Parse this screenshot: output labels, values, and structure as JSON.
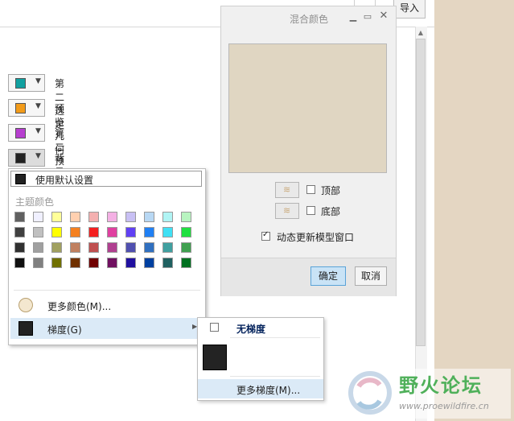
{
  "toolbar": {
    "import_label": "导入"
  },
  "color_rows": [
    {
      "label": "第二选定",
      "color": "#11a0a0"
    },
    {
      "label": "预览几何",
      "color": "#f29b1a"
    },
    {
      "label": "第二预览几何",
      "color": "#b63ecf"
    },
    {
      "label": "背景",
      "color": "#222222"
    }
  ],
  "color_menu": {
    "use_default_label": "使用默认设置",
    "theme_colors_label": "主题颜色",
    "palette": [
      [
        "#606060",
        "#f0f0ff",
        "#ffff99",
        "#ffd0b0",
        "#f4b0b0",
        "#f4b0e4",
        "#c8c0f4",
        "#b8d8f4",
        "#b0f4f4",
        "#b8f4c0"
      ],
      [
        "#404040",
        "#c0c0c0",
        "#ffff00",
        "#f48020",
        "#f42020",
        "#e040a0",
        "#6040f4",
        "#2080f4",
        "#40e0f4",
        "#20e040"
      ],
      [
        "#303030",
        "#a0a0a0",
        "#a0a060",
        "#c08060",
        "#c05050",
        "#b04090",
        "#5050b0",
        "#3070c0",
        "#40a0a0",
        "#40a050"
      ],
      [
        "#101010",
        "#808080",
        "#707000",
        "#703000",
        "#700000",
        "#701060",
        "#2010a0",
        "#0040a0",
        "#206060",
        "#007020"
      ]
    ],
    "more_colors_label": "更多颜色(M)...",
    "gradient_label": "梯度(G)",
    "swatch_color": "#222222"
  },
  "gradient_menu": {
    "no_gradient_label": "无梯度",
    "more_gradient_label": "更多梯度(M)...",
    "sample_color": "#232323"
  },
  "blend_dialog": {
    "title": "混合颜色",
    "preview_color": "#e0d6c2",
    "top_label": "顶部",
    "bottom_label": "底部",
    "dynamic_label": "动态更新模型窗口",
    "dynamic_checked": true,
    "ok_label": "确定",
    "cancel_label": "取消"
  },
  "watermark": {
    "title": "野火论坛",
    "url": "www.proewildfire.cn"
  }
}
